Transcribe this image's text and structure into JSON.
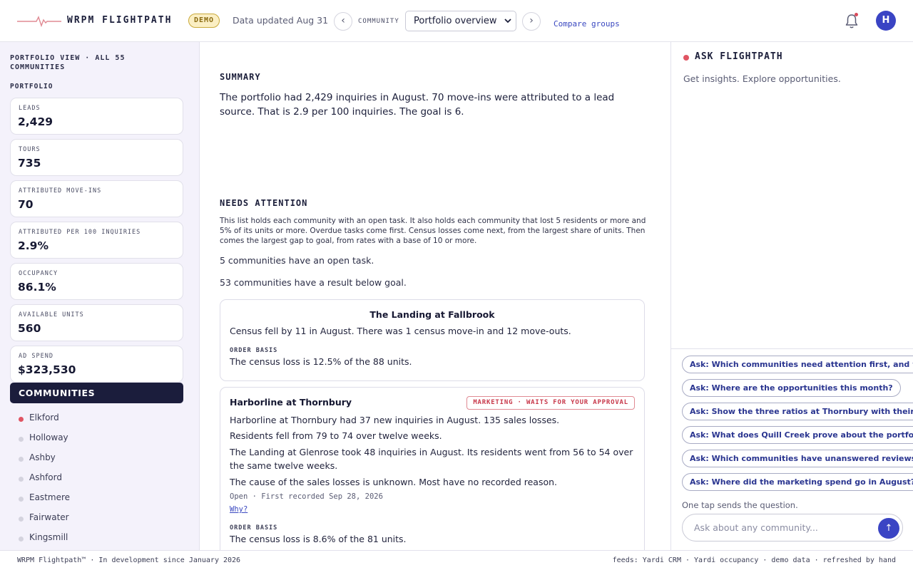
{
  "header": {
    "brand": "WRPM FLIGHTPATH",
    "demo_badge": "DEMO",
    "updated": "Data updated Aug 31",
    "community_label": "COMMUNITY",
    "community_selected": "Portfolio overview",
    "compare": "Compare groups",
    "avatar_initial": "H",
    "prev_glyph": "‹",
    "next_glyph": "›",
    "icons": [
      "pulse-logo-icon",
      "chevron-left-icon",
      "chevron-right-icon",
      "chevron-down-icon",
      "bell-icon",
      "send-arrow-icon"
    ]
  },
  "sidebar": {
    "view_label": "PORTFOLIO VIEW · ALL 55 COMMUNITIES",
    "portfolio_label": "PORTFOLIO",
    "metrics": [
      {
        "label": "LEADS",
        "value": "2,429"
      },
      {
        "label": "TOURS",
        "value": "735"
      },
      {
        "label": "ATTRIBUTED MOVE-INS",
        "value": "70"
      },
      {
        "label": "ATTRIBUTED PER 100 INQUIRIES",
        "value": "2.9%"
      },
      {
        "label": "OCCUPANCY",
        "value": "86.1%"
      },
      {
        "label": "AVAILABLE UNITS",
        "value": "560"
      },
      {
        "label": "AD SPEND",
        "value": "$323,530"
      }
    ],
    "communities_heading": "COMMUNITIES",
    "communities": [
      "Elkford",
      "Holloway",
      "Ashby",
      "Ashford",
      "Eastmere",
      "Fairwater",
      "Kingsmill"
    ]
  },
  "main": {
    "summary_title": "SUMMARY",
    "summary_text": "The portfolio had 2,429 inquiries in August. 70 move-ins were attributed to a lead source. That is 2.9 per 100 inquiries. The goal is 6.",
    "needs_title": "NEEDS ATTENTION",
    "needs_desc": "This list holds each community with an open task. It also holds each community that lost 5 residents or more and 5% of its units or more. Overdue tasks come first. Census losses come next, from the largest share of units. Then comes the largest gap to goal, from rates with a base of 10 or more.",
    "open_tasks": "5 communities have an open task.",
    "below_goal": "53 communities have a result below goal.",
    "card1": {
      "title": "The Landing at Fallbrook",
      "line": "Census fell by 11 in August. There was 1 census move-in and 12 move-outs.",
      "basis_label": "ORDER BASIS",
      "basis": "The census loss is 12.5% of the 88 units."
    },
    "card2": {
      "title": "Harborline at Thornbury",
      "tag": "MARKETING · WAITS FOR YOUR APPROVAL",
      "line1": "Harborline at Thornbury had 37 new inquiries in August. 135 sales losses.",
      "line2": "Residents fell from 79 to 74 over twelve weeks.",
      "line3": "The Landing at Glenrose took 48 inquiries in August. Its residents went from 56 to 54 over the same twelve weeks.",
      "line4": "The cause of the sales losses is unknown. Most have no recorded reason.",
      "meta": "Open · First recorded Sep 28, 2026",
      "why": "Why?",
      "basis_label": "ORDER BASIS",
      "basis": "The census loss is 8.6% of the 81 units."
    }
  },
  "panel": {
    "title": "ASK FLIGHTPATH",
    "subtitle": "Get insights. Explore opportunities.",
    "chips": [
      "Ask: Which communities need attention first, and why?",
      "Ask: Where are the opportunities this month?",
      "Ask: Show the three ratios at Thornbury with their goals.",
      "Ask: What does Quill Creek prove about the portfolio?",
      "Ask: Which communities have unanswered reviews?",
      "Ask: Where did the marketing spend go in August?"
    ],
    "hint": "One tap sends the question.",
    "placeholder": "Ask about any community...",
    "send_glyph": "↑"
  },
  "footer": {
    "left": "WRPM Flightpath™ · In development since January 2026",
    "right": "feeds: Yardi CRM · Yardi occupancy · demo data · refreshed by hand"
  },
  "colors": {
    "accent": "#3a44c4",
    "navy": "#1b1d3c",
    "alert": "#e05563",
    "sidebar_bg": "#f4f2fb",
    "demo_bg": "#fbefc4"
  }
}
